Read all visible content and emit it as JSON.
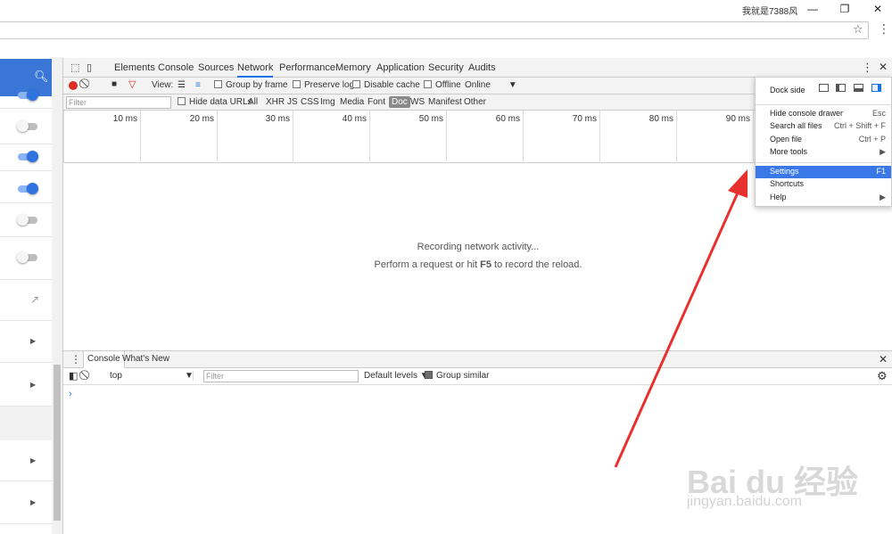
{
  "window": {
    "user_label": "我就是7388风",
    "min": "—",
    "restore": "❐",
    "close": "✕"
  },
  "addressbar": {
    "star": "☆",
    "menu": "⋮"
  },
  "devtools": {
    "tabs": [
      "Elements",
      "Console",
      "Sources",
      "Network",
      "Performance",
      "Memory",
      "Application",
      "Security",
      "Audits"
    ],
    "active_tab": "Network",
    "network_toolbar": {
      "view_label": "View:",
      "group_by_frame": "Group by frame",
      "preserve_log": "Preserve log",
      "disable_cache": "Disable cache",
      "offline": "Offline",
      "throttle": "Online"
    },
    "filter_bar": {
      "filter_placeholder": "Filter",
      "hide_data_urls": "Hide data URLs",
      "types": [
        "All",
        "XHR",
        "JS",
        "CSS",
        "Img",
        "Media",
        "Font",
        "Doc",
        "WS",
        "Manifest",
        "Other"
      ],
      "active_type": "Doc"
    },
    "timeline_ticks": [
      "10 ms",
      "20 ms",
      "30 ms",
      "40 ms",
      "50 ms",
      "60 ms",
      "70 ms",
      "80 ms",
      "90 ms"
    ],
    "empty_state": {
      "line1": "Recording network activity...",
      "line2_prefix": "Perform a request or hit ",
      "line2_key": "F5",
      "line2_suffix": " to record the reload."
    },
    "drawer": {
      "tabs": [
        "Console",
        "What's New"
      ],
      "context": "top",
      "filter_placeholder": "Filter",
      "levels": "Default levels ▼",
      "group_similar": "Group similar",
      "prompt": "›"
    }
  },
  "menu": {
    "dock_side": "Dock side",
    "items": [
      {
        "label": "Hide console drawer",
        "shortcut": "Esc"
      },
      {
        "label": "Search all files",
        "shortcut": "Ctrl + Shift + F"
      },
      {
        "label": "Open file",
        "shortcut": "Ctrl + P"
      },
      {
        "label": "More tools",
        "shortcut": "▶"
      },
      {
        "label": "Settings",
        "shortcut": "F1"
      },
      {
        "label": "Shortcuts",
        "shortcut": ""
      },
      {
        "label": "Help",
        "shortcut": "▶"
      }
    ]
  },
  "watermark": {
    "brand": "Bai du 经验",
    "url": "jingyan.baidu.com"
  },
  "colors": {
    "accent": "#1a73e8",
    "arrow": "#e8312f",
    "highlight": "#3b78e7",
    "record": "#d93025"
  }
}
